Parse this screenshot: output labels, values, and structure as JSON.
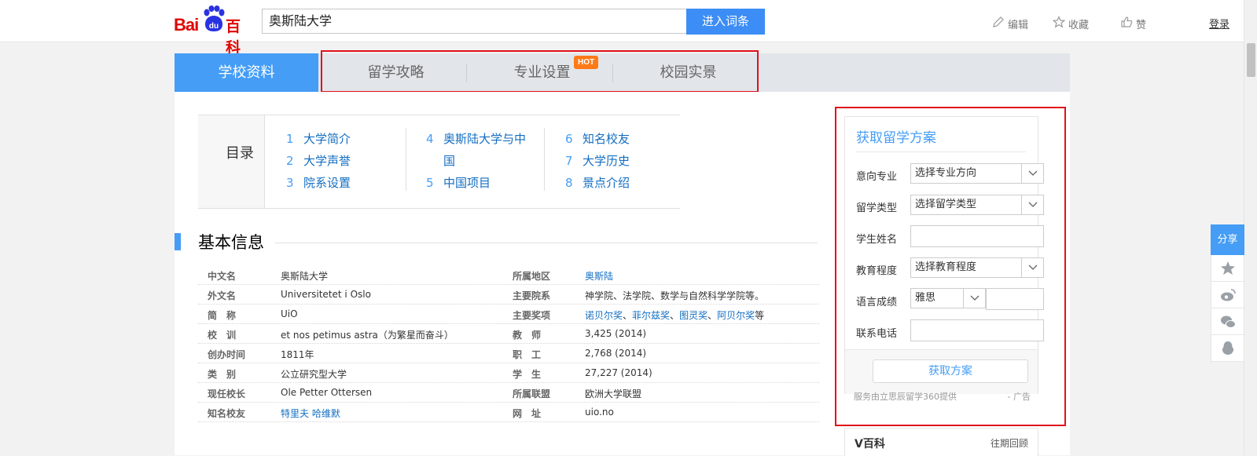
{
  "header": {
    "logo_bai": "Bai",
    "logo_du": "du",
    "logo_baike": "百科",
    "search_value": "奥斯陆大学",
    "search_button": "进入词条",
    "edit": "编辑",
    "favorite": "收藏",
    "like": "赞",
    "login": "登录"
  },
  "tabs": {
    "active": "学校资料",
    "items": [
      "留学攻略",
      "专业设置",
      "校园实景"
    ],
    "hot_badge": "HOT"
  },
  "toc": {
    "title": "目录",
    "items": [
      {
        "num": "1",
        "label": "大学简介"
      },
      {
        "num": "2",
        "label": "大学声誉"
      },
      {
        "num": "3",
        "label": "院系设置"
      },
      {
        "num": "4",
        "label": "奥斯陆大学与中"
      },
      {
        "num": "",
        "label": "国"
      },
      {
        "num": "5",
        "label": "中国项目"
      },
      {
        "num": "6",
        "label": "知名校友"
      },
      {
        "num": "7",
        "label": "大学历史"
      },
      {
        "num": "8",
        "label": "景点介绍"
      }
    ]
  },
  "section": {
    "title": "基本信息"
  },
  "info": {
    "left": [
      {
        "label": "中文名",
        "value": "奥斯陆大学"
      },
      {
        "label": "外文名",
        "value": "Universitetet i Oslo"
      },
      {
        "label": "简　称",
        "value": "UiO"
      },
      {
        "label": "校　训",
        "value": "et nos petimus astra（为繁星而奋斗）"
      },
      {
        "label": "创办时间",
        "value": "1811年"
      },
      {
        "label": "类　别",
        "value": "公立研究型大学"
      },
      {
        "label": "现任校长",
        "value": "Ole Petter Ottersen"
      },
      {
        "label": "知名校友",
        "value": "特里夫 哈维默"
      }
    ],
    "right": [
      {
        "label": "所属地区",
        "value": "奥斯陆"
      },
      {
        "label": "主要院系",
        "value": "神学院、法学院、数学与自然科学学院等。"
      },
      {
        "label": "主要奖项",
        "v1": "诺贝尔奖",
        "s1": "、",
        "v2": "菲尔兹奖",
        "s2": "、",
        "v3": "图灵奖",
        "s3": "、",
        "v4": "阿贝尔奖",
        "tail": "等"
      },
      {
        "label": "教　师",
        "value": "3,425 (2014)"
      },
      {
        "label": "职　工",
        "value": "2,768 (2014)"
      },
      {
        "label": "学　生",
        "value": "27,227 (2014)"
      },
      {
        "label": "所属联盟",
        "value": "欧洲大学联盟"
      },
      {
        "label": "网　址",
        "value": "uio.no"
      }
    ]
  },
  "side": {
    "title": "获取留学方案",
    "major_label": "意向专业",
    "major_value": "选择专业方向",
    "type_label": "留学类型",
    "type_value": "选择留学类型",
    "name_label": "学生姓名",
    "edu_label": "教育程度",
    "edu_value": "选择教育程度",
    "lang_label": "语言成绩",
    "lang_value": "雅思",
    "phone_label": "联系电话",
    "button": "获取方案",
    "note": "服务由立思辰留学360提供",
    "ad": "- 广告"
  },
  "vbaike": {
    "title": "V百科",
    "more": "往期回顾"
  },
  "share": {
    "label": "分享"
  }
}
